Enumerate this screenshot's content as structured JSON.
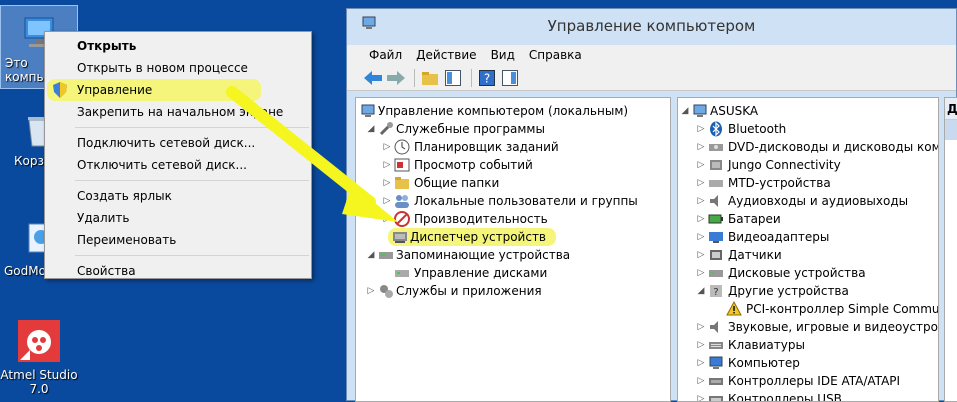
{
  "desktop": {
    "icons": [
      {
        "label": "Это компьютер"
      },
      {
        "label": "Корзина"
      },
      {
        "label": "GodMode"
      },
      {
        "label": "Atmel Studio 7.0"
      }
    ]
  },
  "context_menu": {
    "items": [
      {
        "label": "Открыть"
      },
      {
        "label": "Открыть в новом процессе"
      },
      {
        "label": "Управление"
      },
      {
        "label": "Закрепить на начальном экране"
      },
      {
        "label": "Подключить сетевой диск..."
      },
      {
        "label": "Отключить сетевой диск..."
      },
      {
        "label": "Создать ярлык"
      },
      {
        "label": "Удалить"
      },
      {
        "label": "Переименовать"
      },
      {
        "label": "Свойства"
      }
    ]
  },
  "window": {
    "title": "Управление компьютером",
    "menu": [
      "Файл",
      "Действие",
      "Вид",
      "Справка"
    ]
  },
  "left_tree": [
    "Управление компьютером (локальным)",
    "Служебные программы",
    "Планировщик заданий",
    "Просмотр событий",
    "Общие папки",
    "Локальные пользователи и группы",
    "Производительность",
    "Диспетчер устройств",
    "Запоминающие устройства",
    "Управление дисками",
    "Службы и приложения"
  ],
  "right_tree": [
    "ASUSKA",
    "Bluetooth",
    "DVD-дисководы и дисководы компа",
    "Jungo Connectivity",
    "MTD-устройства",
    "Аудиовходы и аудиовыходы",
    "Батареи",
    "Видеоадаптеры",
    "Датчики",
    "Дисковые устройства",
    "Другие устройства",
    "PCI-контроллер Simple Commun",
    "Звуковые, игровые и видеоустройс",
    "Клавиатуры",
    "Компьютер",
    "Контроллеры IDE ATA/ATAPI",
    "Контроллеры USB"
  ],
  "actions_header": "Д",
  "colors": {
    "desktop": "#0a4a9e",
    "highlight": "#f4f57a",
    "arrow": "#f5f520"
  }
}
